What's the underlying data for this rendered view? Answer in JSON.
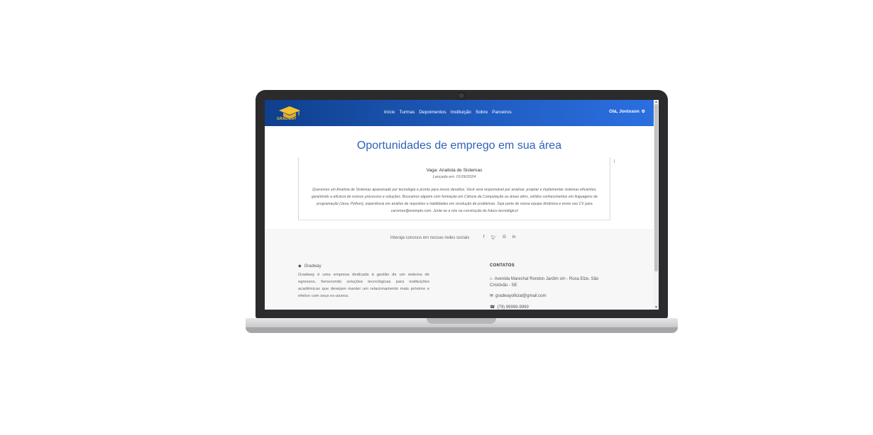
{
  "navbar": {
    "logo_text": "GRADWAY",
    "links": [
      "Início",
      "Turmas",
      "Depoimentos",
      "Instituição",
      "Sobre",
      "Parceiros"
    ],
    "user": "Olá, Jonisson"
  },
  "main": {
    "title": "Oportunidades de emprego em sua área",
    "job": {
      "title": "Vaga: Analista de Sistemas",
      "date": "Lançada em: 01/06/2024",
      "description": "Queremos um Analista de Sistemas apaixonado por tecnologia e pronto para novos desafios. Você será responsável por analisar, projetar e implementar sistemas eficientes, garantindo a eficácia de nossos processos e soluções. Buscamos alguém com formação em Ciência da Computação ou áreas afins, sólidos conhecimentos em linguagens de programação (Java, Python), experiência em análise de requisitos e habilidades em resolução de problemas. Seja parte de nossa equipe dinâmica e envie seu CV para carreiras@exemplo.com. Junte-se a nós na construção do futuro tecnológico!"
    }
  },
  "social": {
    "text": "Interaja conosco em nossas redes sociais",
    "icons": [
      "facebook-icon",
      "twitter-icon",
      "google-icon",
      "linkedin-icon"
    ]
  },
  "footer": {
    "brand": "Gradway",
    "about": "Gradway é uma empresa dedicada à gestão de um sistema de egressos, fornecendo soluções tecnológicas para instituições acadêmicas que desejam manter um relacionamento mais próximo e efetivo com seus ex-alunos.",
    "contacts_title": "CONTATOS",
    "address": "Avenida Marechal Rondon Jardim s/n - Rosa Elze, São Cristóvão - SE",
    "email": "gradwayoficial@gmail.com",
    "phone": "(79) 99999-9999"
  }
}
